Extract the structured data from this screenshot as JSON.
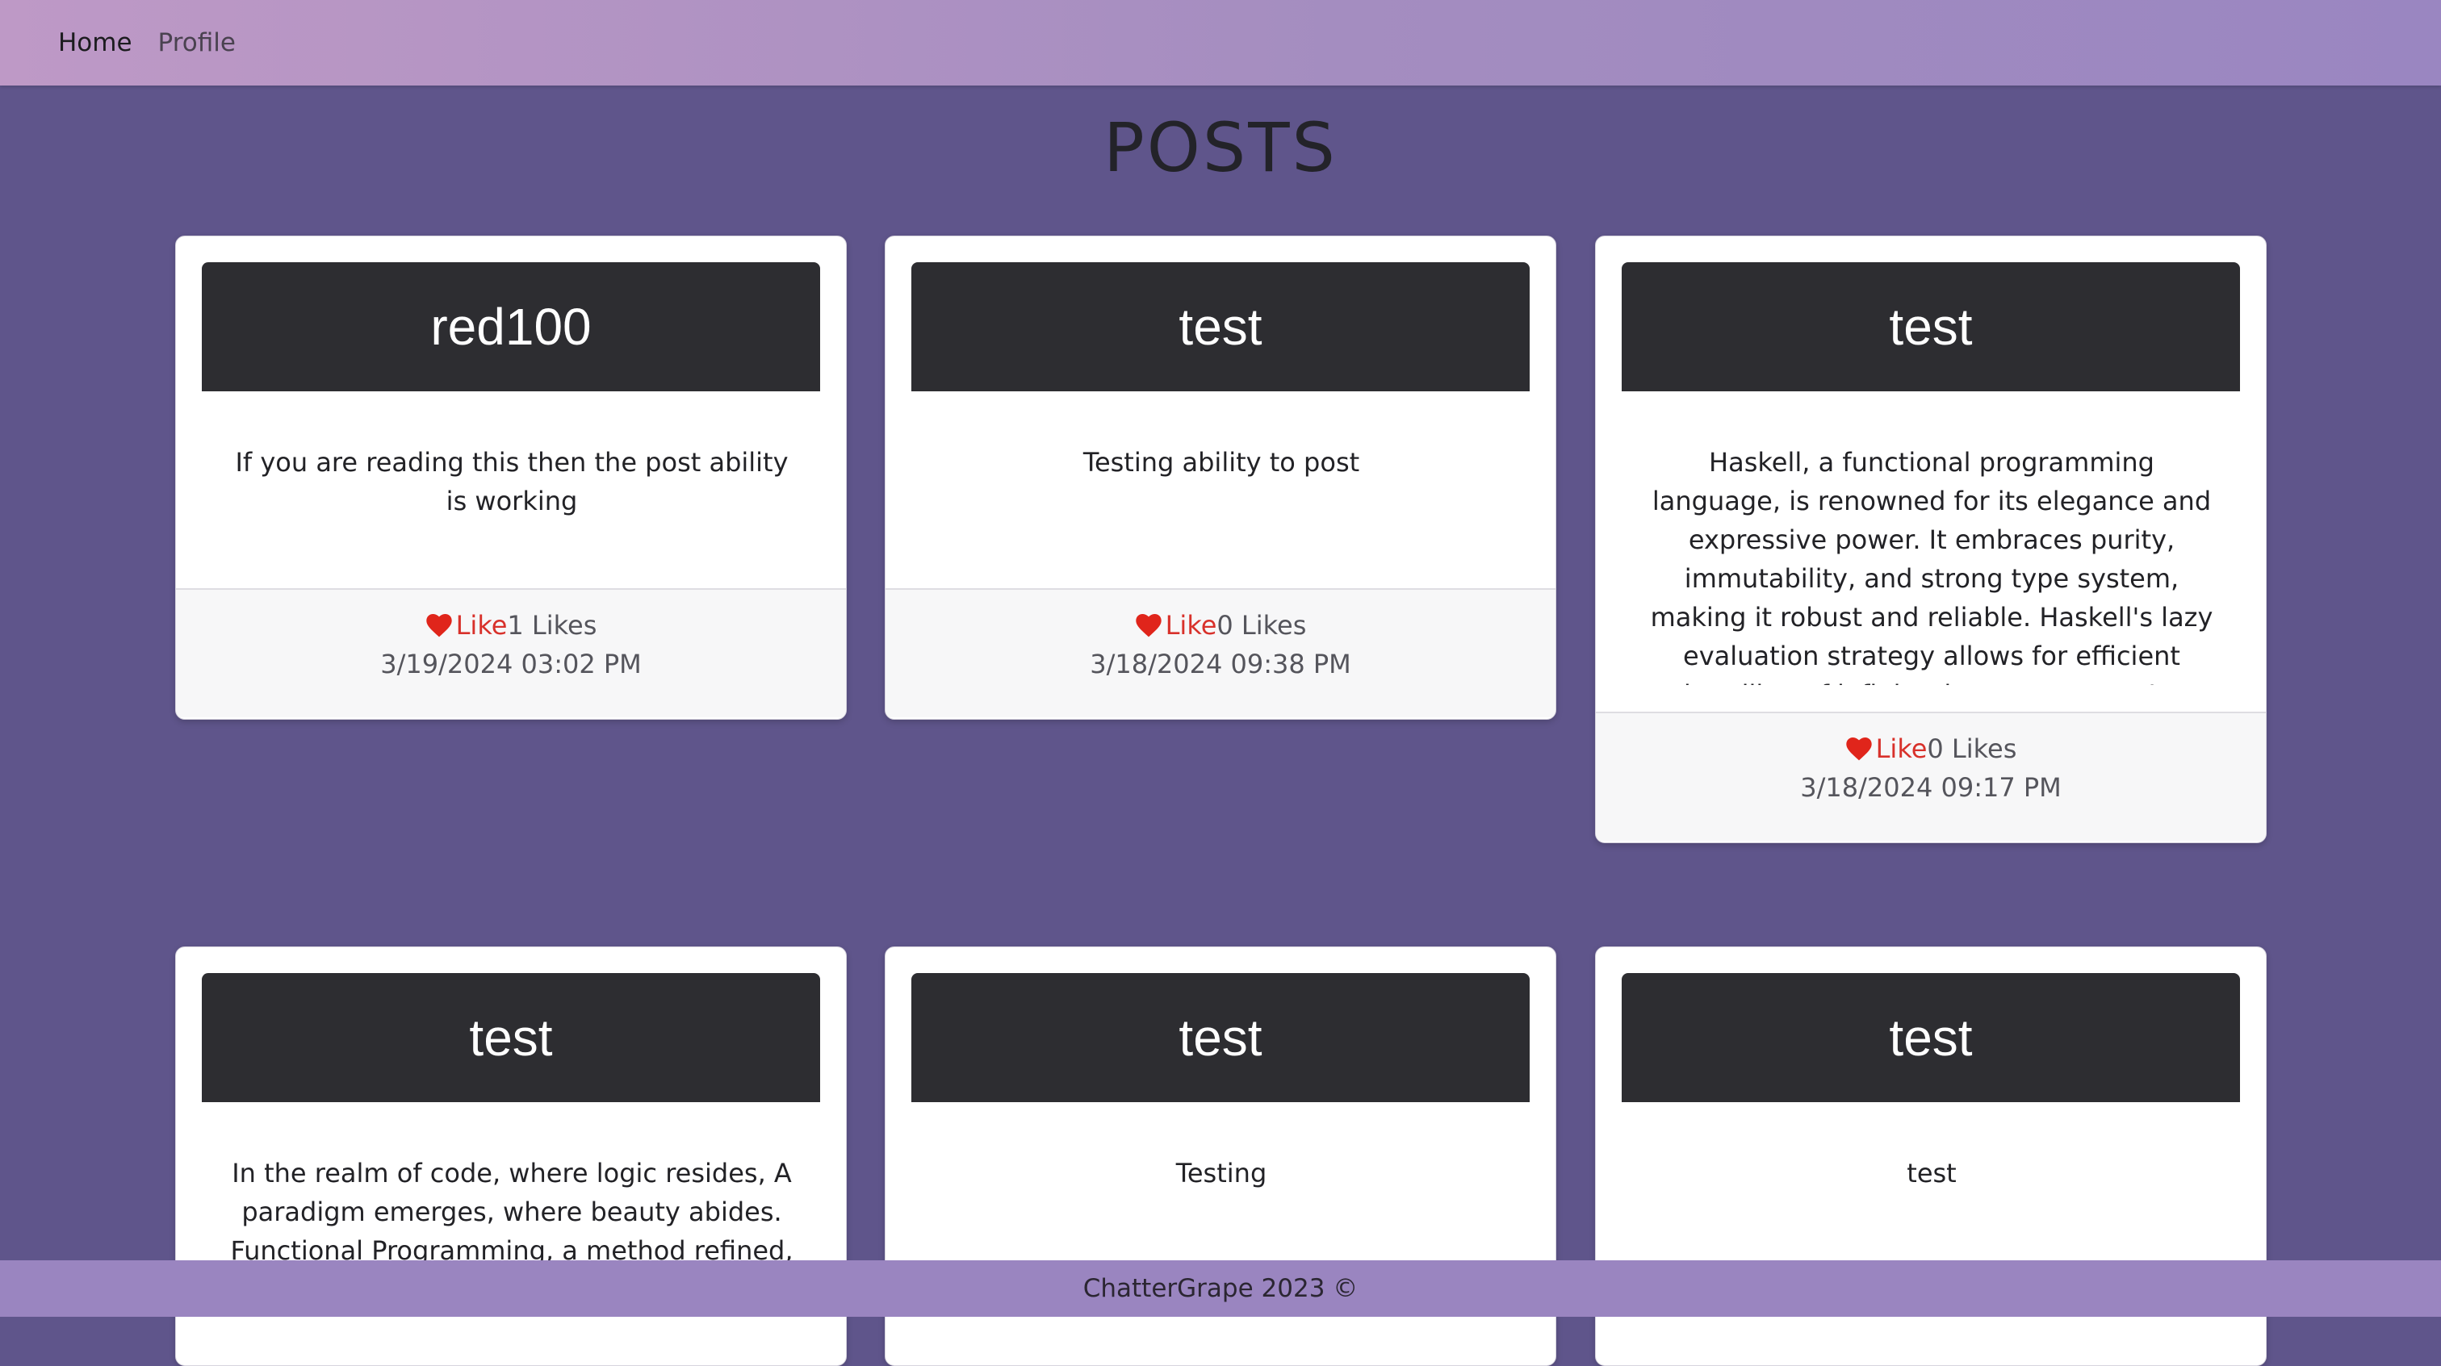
{
  "nav": {
    "home_label": "Home",
    "profile_label": "Profile"
  },
  "page_title": "POSTS",
  "posts": [
    {
      "author": "red100",
      "body": "If you are reading this then the post ability is working",
      "like_label": "Like",
      "likes_text": "1 Likes",
      "date": "3/19/2024 03:02 PM"
    },
    {
      "author": "test",
      "body": "Testing ability to post",
      "like_label": "Like",
      "likes_text": "0 Likes",
      "date": "3/18/2024 09:38 PM"
    },
    {
      "author": "test",
      "body": "Haskell, a functional programming language, is renowned for its elegance and expressive power. It embraces purity, immutability, and strong type system, making it robust and reliable. Haskell's lazy evaluation strategy allows for efficient handling of infinite data structures. Its static type",
      "like_label": "Like",
      "likes_text": "0 Likes",
      "date": "3/18/2024 09:17 PM"
    },
    {
      "author": "test",
      "body": "In the realm of code, where logic resides, A paradigm emerges, where beauty abides. Functional Programming, a method refined, To"
    },
    {
      "author": "test",
      "body": "Testing"
    },
    {
      "author": "test",
      "body": "test"
    }
  ],
  "footer_text": "ChatterGrape 2023 ©",
  "colors": {
    "heart": "#e0251b",
    "like_text": "#d8312b",
    "header_bg": "#2d2d31",
    "page_bg": "#5f558b"
  },
  "icons": {
    "like": "heart-icon"
  }
}
